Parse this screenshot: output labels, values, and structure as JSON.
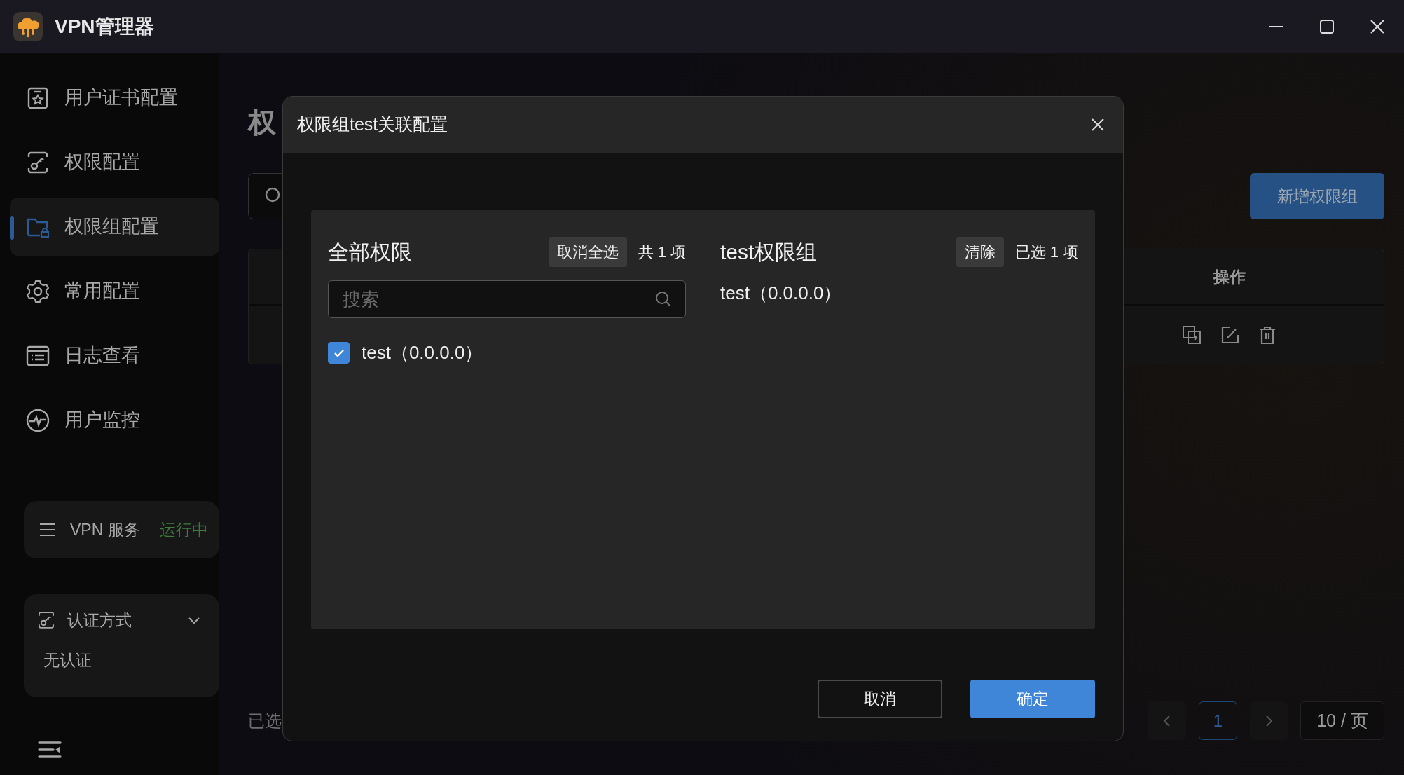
{
  "window": {
    "title": "VPN管理器"
  },
  "sidebar": {
    "items": [
      {
        "label": "用户证书配置",
        "selected": false
      },
      {
        "label": "权限配置",
        "selected": false
      },
      {
        "label": "权限组配置",
        "selected": true
      },
      {
        "label": "常用配置",
        "selected": false
      },
      {
        "label": "日志查看",
        "selected": false
      },
      {
        "label": "用户监控",
        "selected": false
      }
    ],
    "service": {
      "label": "VPN 服务",
      "status": "运行中"
    },
    "auth": {
      "label": "认证方式",
      "expanded": true,
      "value": "无认证"
    }
  },
  "page": {
    "title": "权",
    "add_button": "新增权限组",
    "table": {
      "columns": [
        "操作"
      ]
    },
    "footer_text": "已选",
    "pagination": {
      "pages": [
        {
          "label": "1",
          "selected": true
        }
      ],
      "page_size": "10 / 页"
    }
  },
  "dialog": {
    "title": "权限组test关联配置",
    "source": {
      "title": "全部权限",
      "action": "取消全选",
      "count": "共 1 项",
      "search": {
        "placeholder": "搜索"
      },
      "items": [
        {
          "label": "test（0.0.0.0）",
          "checked": true
        }
      ]
    },
    "target": {
      "title": "test权限组",
      "action": "清除",
      "count": "已选 1 项",
      "items": [
        {
          "label": "test（0.0.0.0）"
        }
      ]
    },
    "buttons": [
      {
        "label": "取消",
        "kind": "secondary"
      },
      {
        "label": "确定",
        "kind": "primary"
      }
    ]
  }
}
